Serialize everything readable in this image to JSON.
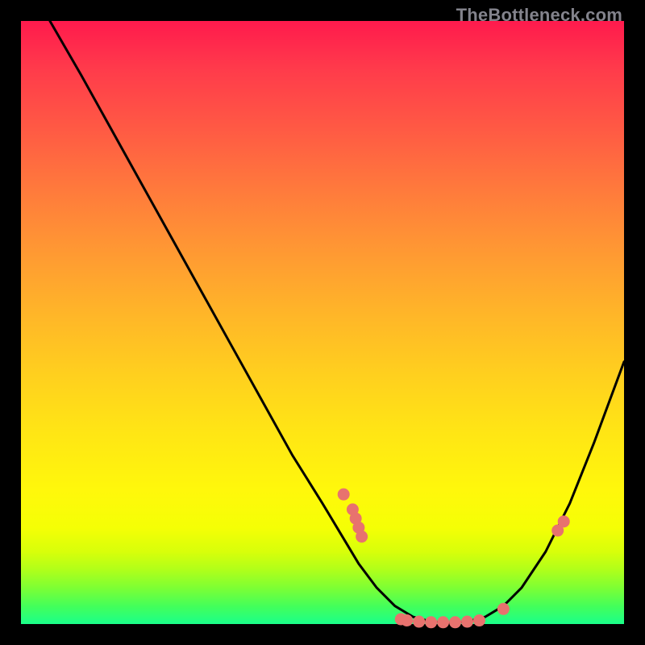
{
  "watermark": "TheBottleneck.com",
  "chart_data": {
    "type": "line",
    "title": "",
    "xlabel": "",
    "ylabel": "",
    "xlim": [
      0,
      100
    ],
    "ylim": [
      0,
      100
    ],
    "curve": [
      {
        "x": 4.8,
        "y": 100.0
      },
      {
        "x": 10.0,
        "y": 91.0
      },
      {
        "x": 15.0,
        "y": 82.0
      },
      {
        "x": 20.0,
        "y": 73.0
      },
      {
        "x": 25.0,
        "y": 64.0
      },
      {
        "x": 30.0,
        "y": 55.0
      },
      {
        "x": 35.0,
        "y": 46.0
      },
      {
        "x": 40.0,
        "y": 37.0
      },
      {
        "x": 45.0,
        "y": 28.0
      },
      {
        "x": 50.0,
        "y": 20.0
      },
      {
        "x": 53.0,
        "y": 15.0
      },
      {
        "x": 56.0,
        "y": 10.0
      },
      {
        "x": 59.0,
        "y": 6.0
      },
      {
        "x": 62.0,
        "y": 3.0
      },
      {
        "x": 65.0,
        "y": 1.2
      },
      {
        "x": 68.0,
        "y": 0.4
      },
      {
        "x": 71.0,
        "y": 0.2
      },
      {
        "x": 74.0,
        "y": 0.4
      },
      {
        "x": 77.0,
        "y": 1.2
      },
      {
        "x": 80.0,
        "y": 3.0
      },
      {
        "x": 83.0,
        "y": 6.0
      },
      {
        "x": 87.0,
        "y": 12.0
      },
      {
        "x": 91.0,
        "y": 20.0
      },
      {
        "x": 95.0,
        "y": 30.0
      },
      {
        "x": 100.0,
        "y": 43.5
      }
    ],
    "markers": [
      {
        "x": 53.5,
        "y": 21.5
      },
      {
        "x": 55.0,
        "y": 19.0
      },
      {
        "x": 55.5,
        "y": 17.5
      },
      {
        "x": 56.0,
        "y": 16.0
      },
      {
        "x": 56.5,
        "y": 14.5
      },
      {
        "x": 63.0,
        "y": 0.8
      },
      {
        "x": 64.0,
        "y": 0.6
      },
      {
        "x": 66.0,
        "y": 0.4
      },
      {
        "x": 68.0,
        "y": 0.3
      },
      {
        "x": 70.0,
        "y": 0.3
      },
      {
        "x": 72.0,
        "y": 0.3
      },
      {
        "x": 74.0,
        "y": 0.4
      },
      {
        "x": 76.0,
        "y": 0.6
      },
      {
        "x": 80.0,
        "y": 2.5
      },
      {
        "x": 89.0,
        "y": 15.5
      },
      {
        "x": 90.0,
        "y": 17.0
      }
    ]
  }
}
